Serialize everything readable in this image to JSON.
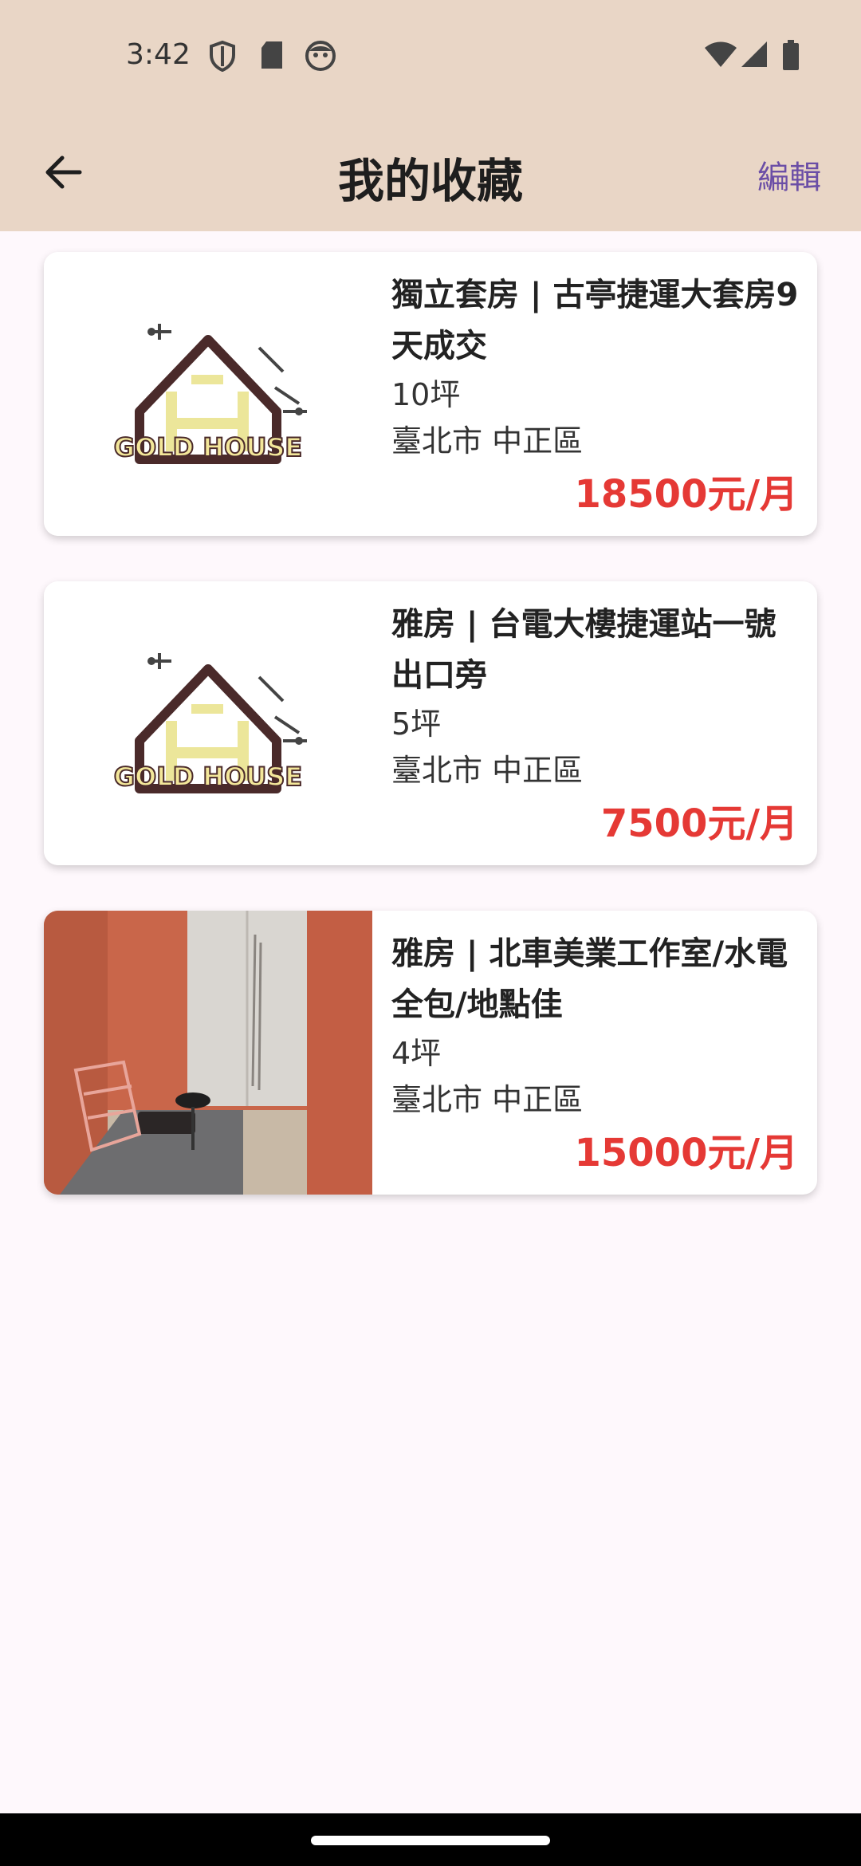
{
  "status_bar": {
    "time": "3:42",
    "left_icons": [
      "shield-icon",
      "sd-card-icon",
      "face-icon"
    ],
    "right_icons": [
      "wifi-icon",
      "signal-icon",
      "battery-icon"
    ]
  },
  "header": {
    "title": "我的收藏",
    "edit_label": "編輯",
    "back_icon": "back-arrow-icon"
  },
  "colors": {
    "header_bg": "#e9d6c6",
    "price": "#e53935",
    "edit": "#6b4ea6",
    "page_bg": "#fef8fc"
  },
  "favorites": [
    {
      "title": "獨立套房 | 古亭捷運大套房9天成交",
      "size": "10坪",
      "location": "臺北市 中正區",
      "price": "18500元/月",
      "image": "gold-house-logo"
    },
    {
      "title": "雅房 | 台電大樓捷運站一號出口旁",
      "size": "5坪",
      "location": "臺北市 中正區",
      "price": "7500元/月",
      "image": "gold-house-logo"
    },
    {
      "title": "雅房 | 北車美業工作室/水電全包/地點佳",
      "size": "4坪",
      "location": "臺北市 中正區",
      "price": "15000元/月",
      "image": "room-photo"
    }
  ]
}
